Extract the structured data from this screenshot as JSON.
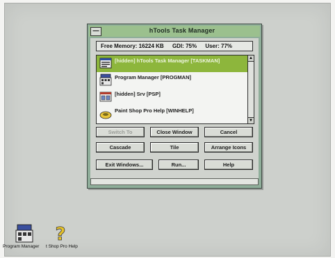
{
  "window": {
    "title": "hTools Task Manager",
    "system_menu_glyph": "—"
  },
  "stats": {
    "free_memory": "Free Memory: 16224 KB",
    "gdi": "GDI: 75%",
    "user": "User: 77%"
  },
  "tasks": [
    {
      "label": "[hidden] hTools Task Manager [TASKMAN]",
      "icon": "task-manager-icon",
      "selected": true
    },
    {
      "label": "Program Manager [PROGMAN]",
      "icon": "program-manager-icon",
      "selected": false
    },
    {
      "label": "[hidden] Srv [PSP]",
      "icon": "service-icon",
      "selected": false
    },
    {
      "label": "Paint Shop Pro Help [WINHELP]",
      "icon": "help-icon",
      "selected": false
    }
  ],
  "scrollbar": {
    "up": "▲",
    "down": "▼"
  },
  "buttons": {
    "switch_to": "Switch To",
    "close_window": "Close Window",
    "cancel": "Cancel",
    "cascade": "Cascade",
    "tile": "Tile",
    "arrange_icons": "Arrange Icons",
    "exit_windows": "Exit Windows...",
    "run": "Run...",
    "help": "Help"
  },
  "desktop_icons": [
    {
      "label": "Program Manager",
      "icon": "program-manager-icon"
    },
    {
      "label": "t Shop Pro Help",
      "icon": "help-question-icon"
    }
  ],
  "colors": {
    "selection": "#8db63c",
    "titlebar": "#9bc08e",
    "dialog_frame": "#8fae9a"
  }
}
